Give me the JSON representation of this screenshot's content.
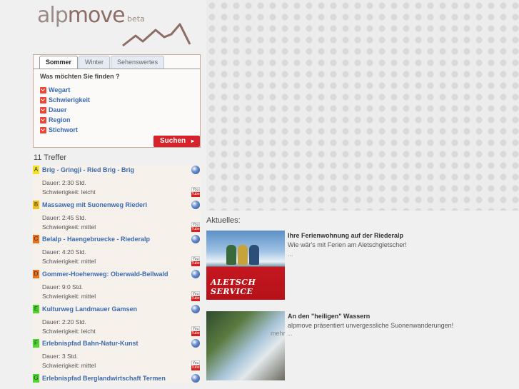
{
  "logo": {
    "alp": "alp",
    "move": "move",
    "beta": "beta"
  },
  "tabs": [
    "Sommer",
    "Winter",
    "Sehenswertes"
  ],
  "panel": {
    "question": "Was möchten Sie finden ?",
    "filters": [
      "Wegart",
      "Schwierigkeit",
      "Dauer",
      "Region",
      "Stichwort"
    ],
    "search_label": "Suchen",
    "search_arrow": "▸"
  },
  "hits": "11 Treffer",
  "results": [
    {
      "marker": "A",
      "marker_color": "#f2e02a",
      "title": "Brig - Gringji - Ried Brig - Brig",
      "duration": "Dauer: 2:30 Std.",
      "difficulty": "Schwierigkeit: leicht"
    },
    {
      "marker": "B",
      "marker_color": "#f2c01a",
      "title": "Massaweg mit Suonenweg Riederi",
      "duration": "Dauer: 2:45 Std.",
      "difficulty": "Schwierigkeit: mittel"
    },
    {
      "marker": "C",
      "marker_color": "#e8721f",
      "title": "Belalp - Haengebruecke - Riederalp",
      "duration": "Dauer: 4:20 Std.",
      "difficulty": "Schwierigkeit: mittel"
    },
    {
      "marker": "D",
      "marker_color": "#e8721f",
      "title": "Gommer-Hoehenweg: Oberwald-Bellwald",
      "duration": "Dauer: 9:0 Std.",
      "difficulty": "Schwierigkeit: mittel"
    },
    {
      "marker": "E",
      "marker_color": "#4cd62e",
      "title": "Kulturweg Landmauer Gamsen",
      "duration": "Dauer: 2:20 Std.",
      "difficulty": "Schwierigkeit: leicht"
    },
    {
      "marker": "F",
      "marker_color": "#4cd62e",
      "title": "Erlebnispfad Bahn-Natur-Kunst",
      "duration": "Dauer: 3 Std.",
      "difficulty": "Schwierigkeit: mittel"
    },
    {
      "marker": "G",
      "marker_color": "#4cd62e",
      "title": "Erlebnispfad Berglandwirtschaft Termen",
      "duration": "",
      "difficulty": ""
    }
  ],
  "youtube": {
    "top": "You",
    "bottom": "Tube"
  },
  "news": {
    "heading": "Aktuelles:",
    "items": [
      {
        "title": "Ihre Ferienwohnung auf der Riederalp",
        "text": "Wie wär's mit Ferien am Aletschgletscher!",
        "more": "...",
        "image_caption": "ALETSCH SERVICE"
      },
      {
        "title": "An den \"heiligen\" Wassern",
        "text": "alpmove präsentiert unvergessliche Suonenwanderungen!",
        "more": "mehr ...",
        "image_caption": ""
      }
    ]
  }
}
